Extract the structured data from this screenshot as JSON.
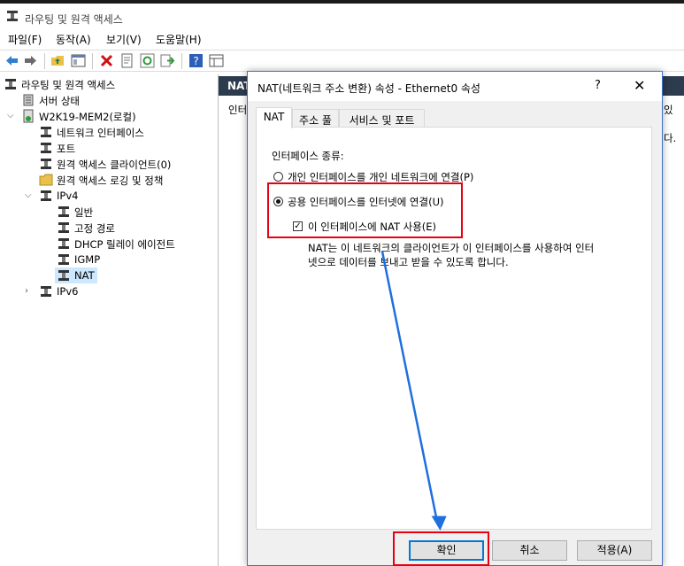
{
  "window": {
    "title": "라우팅 및 원격 액세스"
  },
  "menu": {
    "file": "파일(F)",
    "action": "동작(A)",
    "view": "보기(V)",
    "help": "도움말(H)"
  },
  "tree": {
    "root": "라우팅 및 원격 액세스",
    "server_status": "서버 상태",
    "server": "W2K19-MEM2(로컬)",
    "net_interfaces": "네트워크 인터페이스",
    "ports": "포트",
    "ra_clients": "원격 액세스 클라이언트(0)",
    "ra_logging": "원격 액세스 로깅 및 정책",
    "ipv4": "IPv4",
    "general": "일반",
    "static_routes": "고정 경로",
    "dhcp_relay": "DHCP 릴레이 에이전트",
    "igmp": "IGMP",
    "nat": "NAT",
    "ipv6": "IPv6"
  },
  "right_pane": {
    "header": "NAT",
    "text_fragments": [
      "인터",
      "있 ",
      "다."
    ]
  },
  "dialog": {
    "title": "NAT(네트워크 주소 변환) 속성 - Ethernet0 속성",
    "help_glyph": "?",
    "close_glyph": "✕",
    "tabs": [
      "NAT",
      "주소 풀",
      "서비스 및 포트"
    ],
    "interface_type_label": "인터페이스 종류:",
    "option_private": "개인 인터페이스를 개인 네트워크에 연결(P)",
    "option_public": "공용 인터페이스를 인터넷에 연결(U)",
    "enable_nat": "이 인터페이스에 NAT 사용(E)",
    "enable_nat_checked": true,
    "description_line1": "NAT는 이 네트워크의 클라이언트가 이 인터페이스를 사용하여 인터",
    "description_line2": "넷으로 데이터를 보내고 받을 수 있도록 합니다.",
    "ok": "확인",
    "cancel": "취소",
    "apply": "적용(A)"
  },
  "colors": {
    "highlight": "#e60012",
    "arrow": "#1e6fe0",
    "header_bg": "#2d3b4e",
    "selection": "#cce8ff"
  }
}
